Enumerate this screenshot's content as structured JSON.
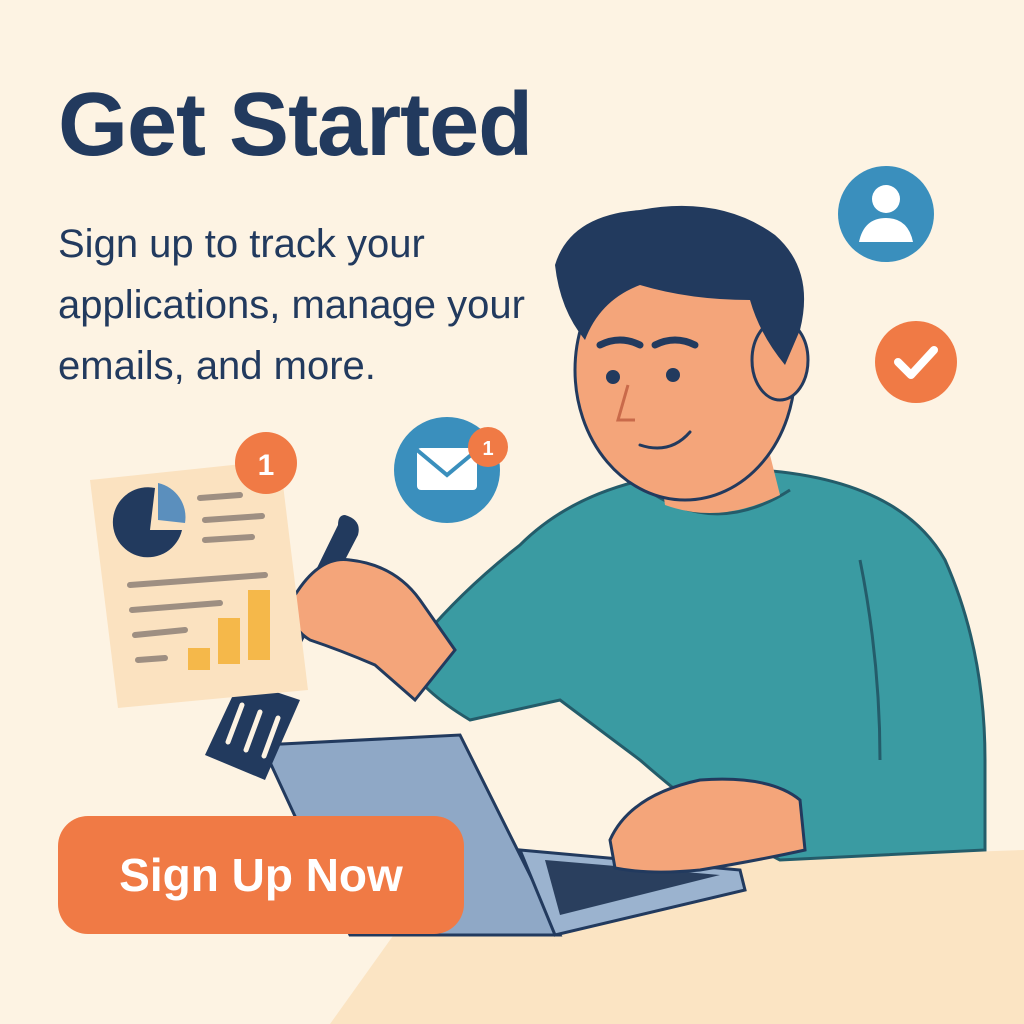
{
  "hero": {
    "title": "Get Started",
    "subtitle": "Sign up to track your applications, manage your emails, and more."
  },
  "cta": {
    "label": "Sign Up Now"
  },
  "badges": {
    "document_count": "1",
    "email_count": "1"
  },
  "icons": {
    "user": "user-icon",
    "check": "check-icon",
    "email": "email-icon",
    "document": "document-icon"
  },
  "colors": {
    "background": "#fdf3e3",
    "heading": "#223a5e",
    "accent_orange": "#f07a45",
    "icon_blue": "#3a8fbd",
    "sweater_teal": "#3a9ba2",
    "bar_yellow": "#f5b84a"
  }
}
